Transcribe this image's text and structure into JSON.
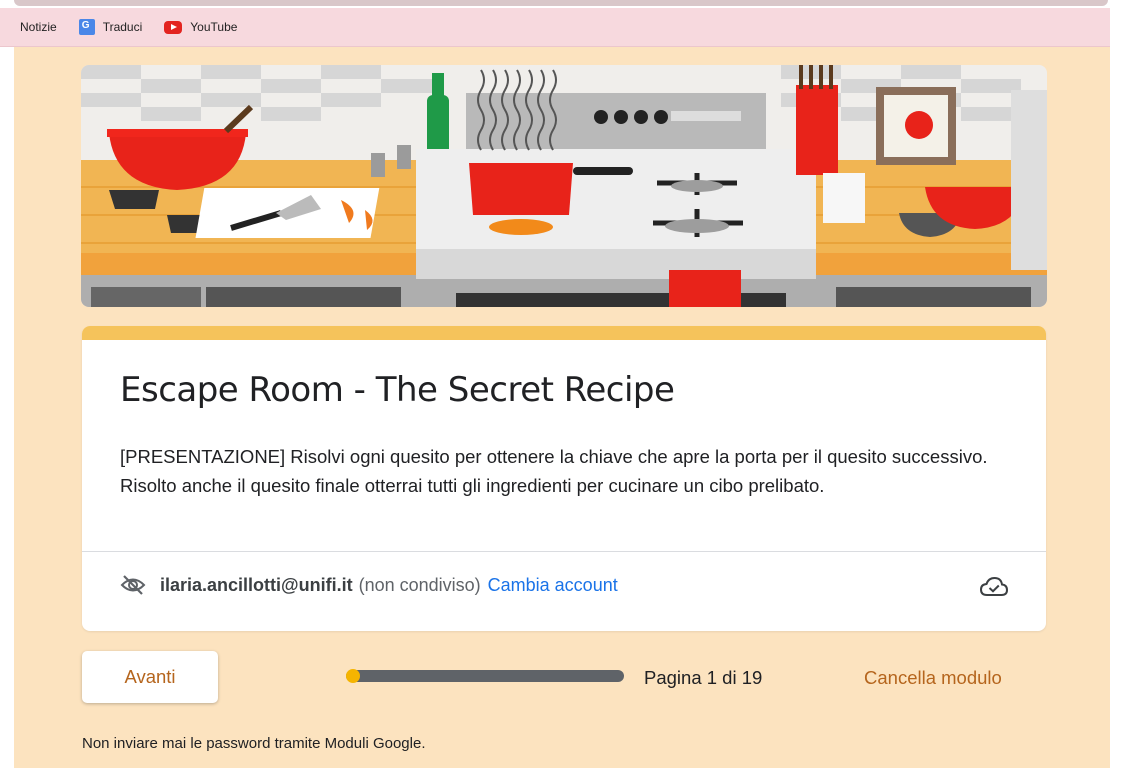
{
  "bookmarks": [
    {
      "label": "Notizie",
      "icon": ""
    },
    {
      "label": "Traduci",
      "icon": "google-translate-icon"
    },
    {
      "label": "YouTube",
      "icon": "youtube-icon"
    }
  ],
  "form": {
    "title": "Escape Room - The Secret Recipe",
    "description": "[PRESENTAZIONE] Risolvi ogni quesito per ottenere la chiave che apre la porta per il quesito successivo. Risolto anche il quesito finale otterrai tutti gli ingredienti per cucinare un cibo prelibato.",
    "account_email": "ilaria.ancillotti@unifi.it",
    "not_shared": "(non condiviso)",
    "switch_account": "Cambia account"
  },
  "nav": {
    "next_label": "Avanti",
    "page_text": "Pagina 1 di 19",
    "page_current": 1,
    "page_total": 19,
    "clear_label": "Cancella modulo"
  },
  "footer": {
    "note": "Non inviare mai le password tramite Moduli Google."
  },
  "colors": {
    "page_bg": "#fce3bf",
    "accent": "#f5c35b",
    "action_text": "#b5651d",
    "link": "#1a73e8",
    "bookmarks_bar": "#f7d9de"
  }
}
